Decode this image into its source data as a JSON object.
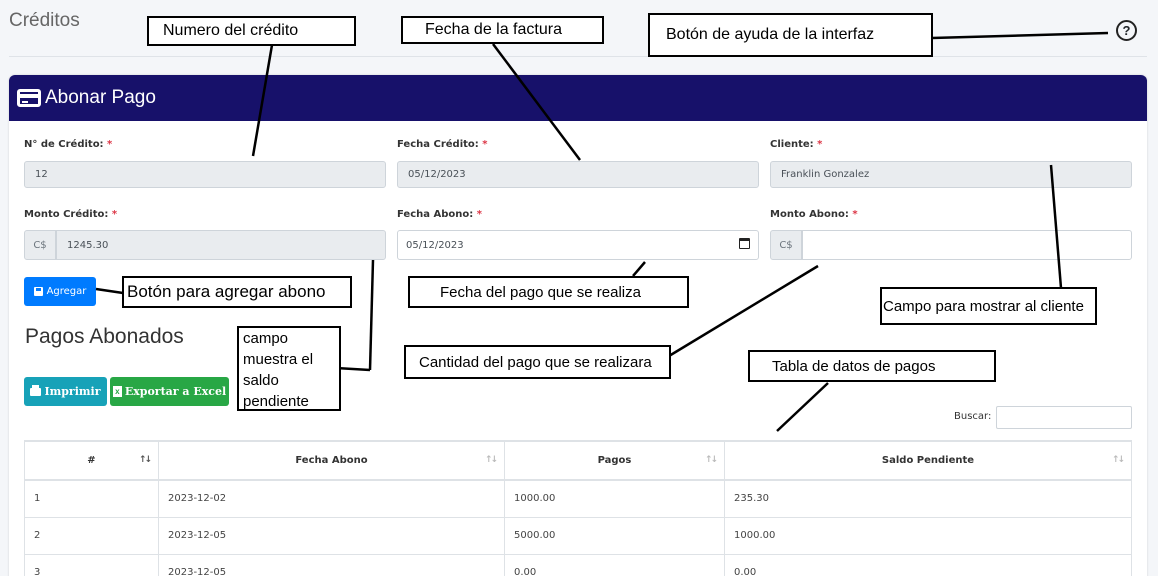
{
  "page": {
    "title": "Créditos"
  },
  "help": {
    "glyph": "?"
  },
  "card": {
    "title": "Abonar Pago"
  },
  "form": {
    "numero_credito": {
      "label": "N° de Crédito:",
      "value": "12"
    },
    "fecha_credito": {
      "label": "Fecha Crédito:",
      "value": "05/12/2023"
    },
    "cliente": {
      "label": "Cliente:",
      "value": "Franklin Gonzalez"
    },
    "monto_credito": {
      "label": "Monto Crédito:",
      "prefix": "C$",
      "value": "1245.30"
    },
    "fecha_abono": {
      "label": "Fecha Abono:",
      "value": "05/12/2023"
    },
    "monto_abono": {
      "label": "Monto Abono:",
      "prefix": "C$",
      "value": ""
    },
    "required_mark": "*"
  },
  "buttons": {
    "agregar": "Agregar",
    "imprimir": "Imprimir",
    "exportar": "Exportar a Excel"
  },
  "section": {
    "title": "Pagos Abonados"
  },
  "search": {
    "label": "Buscar:"
  },
  "table": {
    "headers": [
      "#",
      "Fecha Abono",
      "Pagos",
      "Saldo Pendiente"
    ],
    "rows": [
      [
        "1",
        "2023-12-02",
        "1000.00",
        "235.30"
      ],
      [
        "2",
        "2023-12-05",
        "5000.00",
        "1000.00"
      ],
      [
        "3",
        "2023-12-05",
        "0.00",
        "0.00"
      ]
    ]
  },
  "annotations": {
    "numero": "Numero del crédito",
    "fecha_factura": "Fecha de la factura",
    "ayuda": "Botón de ayuda de la interfaz",
    "agregar": "Botón para agregar abono",
    "fecha_pago": "Fecha del pago que se realiza",
    "mostrar_cliente": "Campo para mostrar al cliente",
    "saldo_lines": [
      "campo",
      "muestra el",
      "saldo",
      "pendiente"
    ],
    "cantidad": "Cantidad del pago que se realizara",
    "tabla": "Tabla de datos de pagos"
  },
  "colors": {
    "header": "#17116a",
    "primary": "#007bff",
    "info": "#17a2b8",
    "success": "#28a745",
    "required": "#dc3545"
  }
}
